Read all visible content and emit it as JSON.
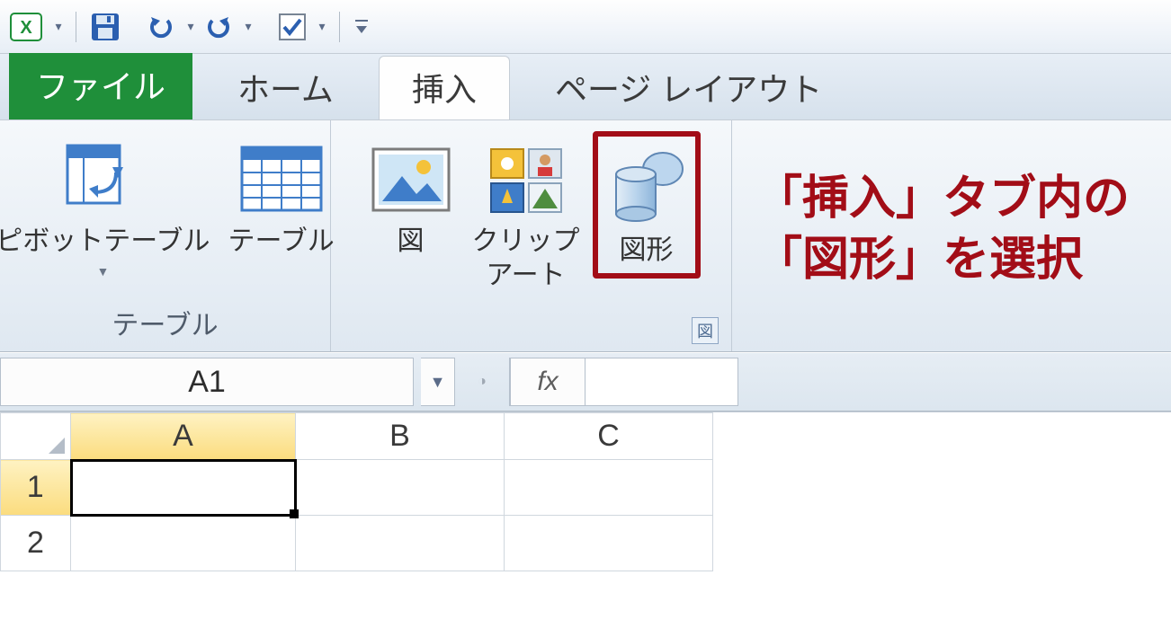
{
  "qat": {
    "undo_tip": "元に戻す",
    "redo_tip": "やり直し",
    "save_tip": "保存",
    "check_tip": "オプション",
    "customize_tip": "クイックアクセスツールバーのユーザー設定"
  },
  "tabs": {
    "file": "ファイル",
    "home": "ホーム",
    "insert": "挿入",
    "page_layout": "ページ レイアウト"
  },
  "ribbon": {
    "tables": {
      "pivot": "ピボットテーブル",
      "table": "テーブル",
      "group": "テーブル"
    },
    "illustrations": {
      "picture": "図",
      "clipart": "クリップ\nアート",
      "shapes": "図形",
      "group_launcher": "図"
    }
  },
  "formula_bar": {
    "name_box": "A1",
    "fx": "fx"
  },
  "sheet": {
    "cols": [
      "A",
      "B",
      "C"
    ],
    "rows": [
      "1",
      "2"
    ]
  },
  "annotation": "「挿入」タブ内の\n「図形」を選択"
}
